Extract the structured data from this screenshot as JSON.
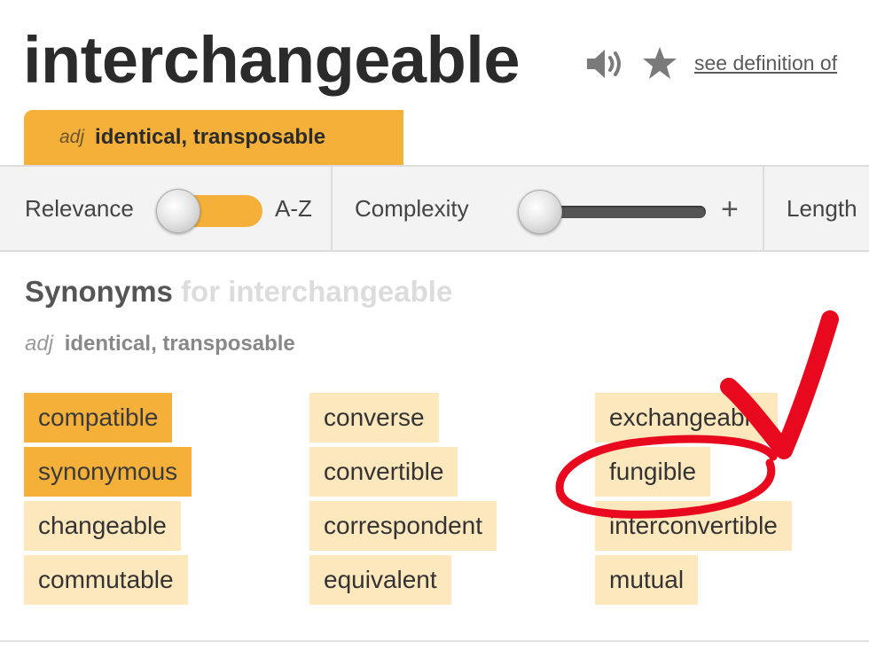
{
  "header": {
    "word": "interchangeable",
    "see_definition": "see definition of"
  },
  "sense_tab": {
    "pos": "adj",
    "definition": "identical, transposable"
  },
  "filters": {
    "relevance_label": "Relevance",
    "az_label": "A-Z",
    "complexity_label": "Complexity",
    "plus": "+",
    "length_label": "Length"
  },
  "synonyms": {
    "heading": "Synonyms",
    "heading_for": "for interchangeable",
    "pos": "adj",
    "definition": "identical, transposable",
    "words": [
      "compatible",
      "synonymous",
      "changeable",
      "commutable",
      "converse",
      "convertible",
      "correspondent",
      "equivalent",
      "exchangeable",
      "fungible",
      "interconvertible",
      "mutual"
    ]
  },
  "colors": {
    "accent": "#f5b03a",
    "synonym_light": "#fde7bd",
    "annotation_red": "#e8091e"
  }
}
